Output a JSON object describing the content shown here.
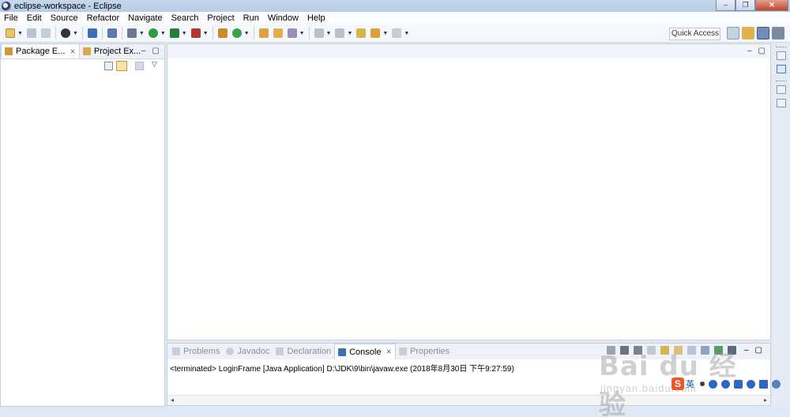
{
  "window": {
    "title": "eclipse-workspace - Eclipse",
    "controls": [
      "–",
      "❐",
      "✕"
    ]
  },
  "menu": [
    "File",
    "Edit",
    "Source",
    "Refactor",
    "Navigate",
    "Search",
    "Project",
    "Run",
    "Window",
    "Help"
  ],
  "toolbar": {
    "quick_access": "Quick Access"
  },
  "left_panel": {
    "tabs": [
      {
        "label": "Package E...",
        "close": "⨯"
      },
      {
        "label": "Project Ex...",
        "close": "⨯"
      }
    ],
    "min_icon": "–",
    "max_icon": "▢"
  },
  "editor": {
    "min_icon": "–",
    "max_icon": "▢"
  },
  "bottom_panel": {
    "tabs": [
      {
        "label": "Problems",
        "active": false
      },
      {
        "label": "Javadoc",
        "active": false
      },
      {
        "label": "Declaration",
        "active": false
      },
      {
        "label": "Console",
        "active": true,
        "close": "⨯"
      },
      {
        "label": "Properties",
        "active": false
      }
    ],
    "console_line": "<terminated> LoginFrame [Java Application] D:\\JDK\\9\\bin\\javaw.exe (2018年8月30日 下午9:27:59)",
    "scroll_left": "◂",
    "scroll_right": "▸"
  },
  "overlay": {
    "watermark_brand": "Bai du 经验",
    "watermark_domain": "jingyan.baidu.com",
    "ime_label": "英"
  },
  "colors": {
    "title_bar": "#b7cce8",
    "panel_border": "#c7d1de",
    "close_button": "#c6442e",
    "ime_accent": "#e95a24"
  }
}
